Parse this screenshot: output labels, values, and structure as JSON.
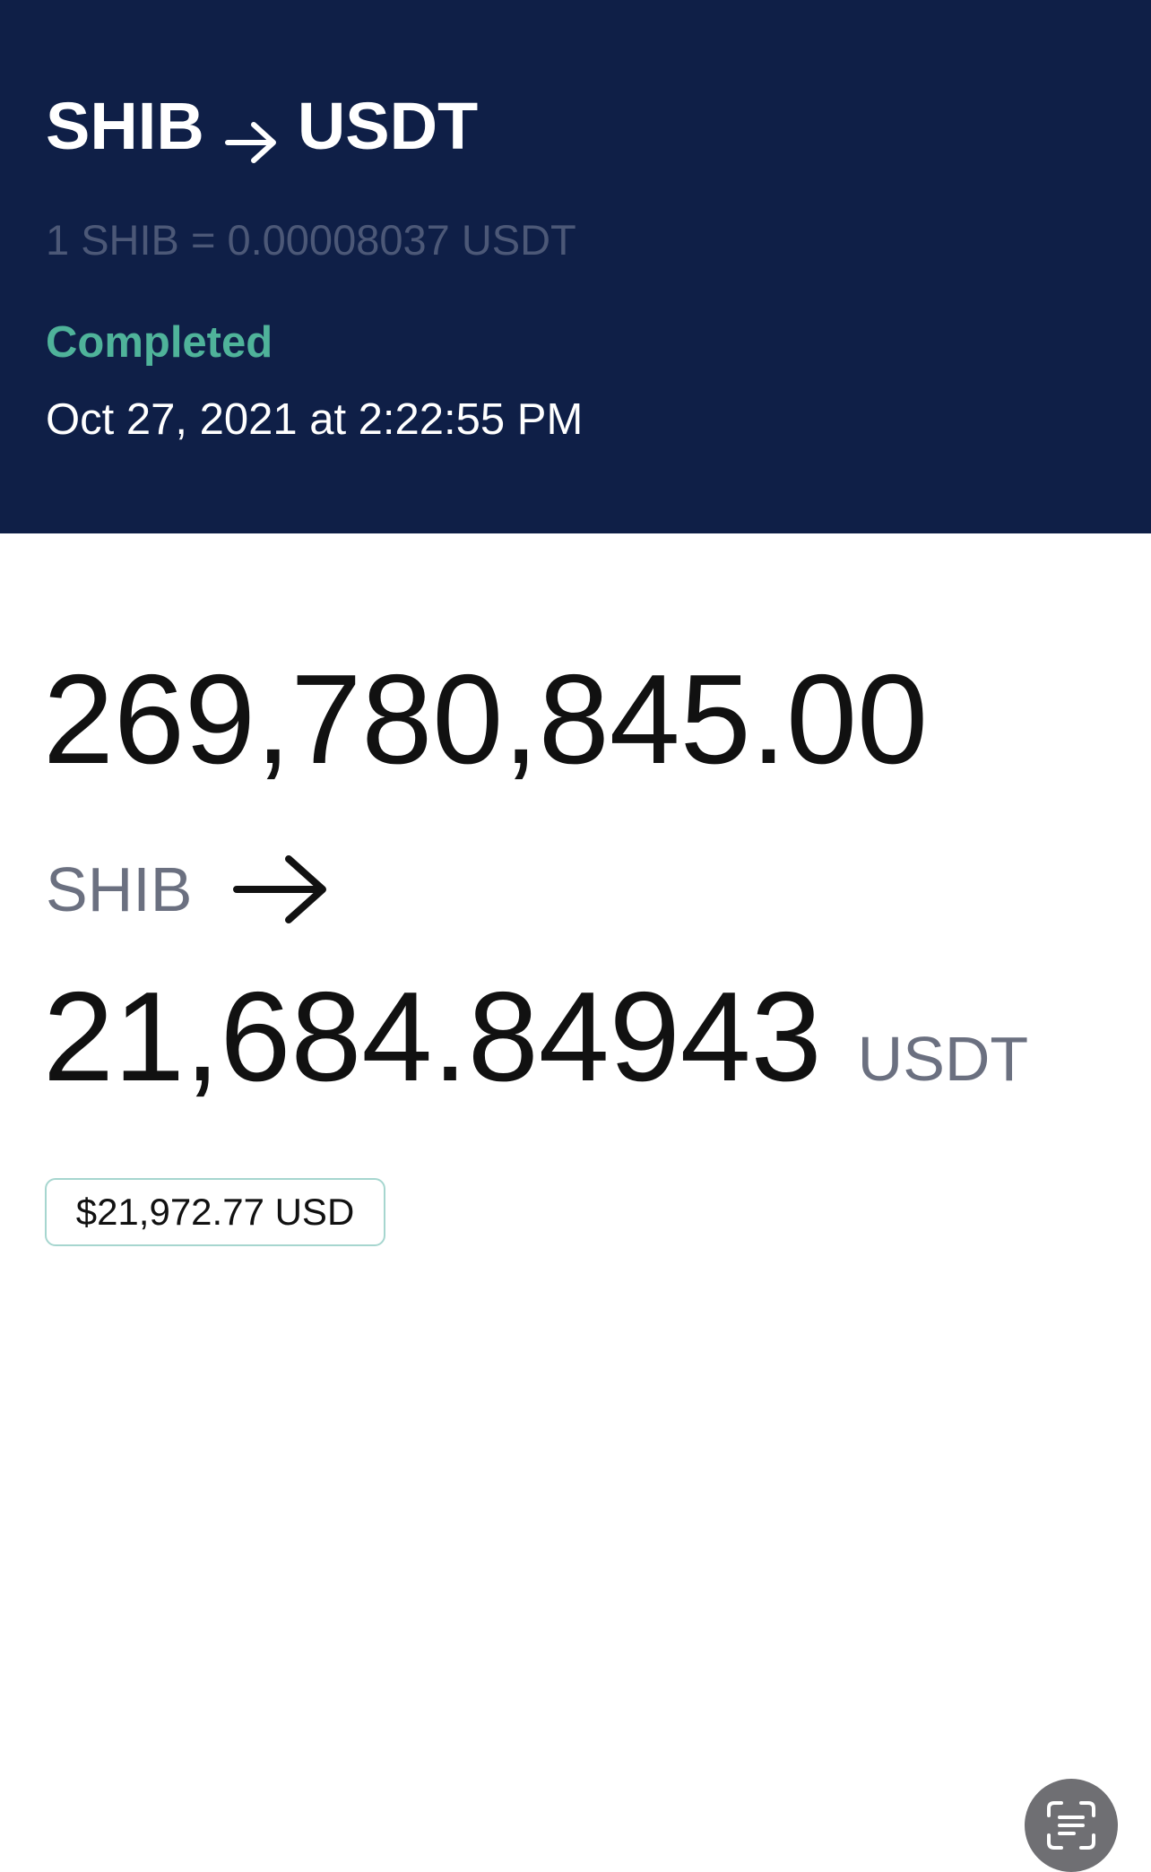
{
  "header": {
    "from_symbol": "SHIB",
    "to_symbol": "USDT",
    "arrow_icon": "arrow-right-icon",
    "rate": "1 SHIB = 0.00008037 USDT",
    "status": "Completed",
    "datetime": "Oct 27, 2021 at 2:22:55 PM"
  },
  "trade": {
    "from_amount": "269,780,845.00",
    "from_currency": "SHIB",
    "arrow_icon": "arrow-right-icon",
    "to_amount": "21,684.84943",
    "to_currency": "USDT",
    "usd_value": "$21,972.77 USD"
  },
  "overlay": {
    "scan_icon": "live-text-scan-icon"
  },
  "colors": {
    "header_bg": "#0f1f47",
    "status": "#4fb39a",
    "rate_text": "#4c5877",
    "badge_border": "#a6d6cf"
  }
}
